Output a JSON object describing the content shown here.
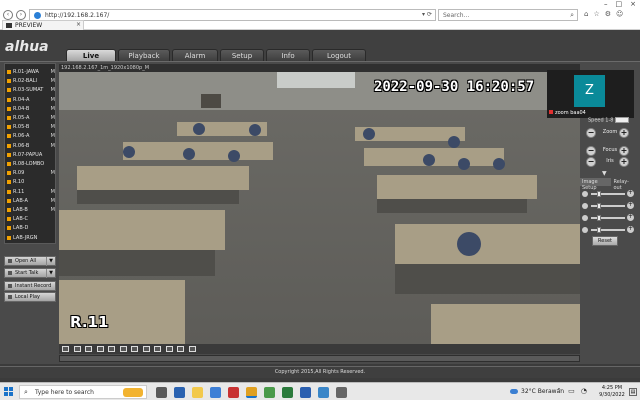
{
  "browser": {
    "url": "http://192.168.2.167/",
    "search_placeholder": "Search...",
    "tab_title": "PREVIEW"
  },
  "app": {
    "logo": "alhua",
    "tabs": [
      "Live",
      "Playback",
      "Alarm",
      "Setup",
      "Info",
      "Logout"
    ],
    "active_tab": "Live",
    "footer": "Copyright 2015,All Rights Reserved."
  },
  "channels": [
    {
      "name": "R.01-JAWA",
      "m": "M"
    },
    {
      "name": "R.02-BALI",
      "m": "M"
    },
    {
      "name": "R.03-SUMAT",
      "m": "M"
    },
    {
      "name": "R.04-A",
      "m": "M"
    },
    {
      "name": "R.04-B",
      "m": "M"
    },
    {
      "name": "R.05-A",
      "m": "M"
    },
    {
      "name": "R.05-B",
      "m": "M"
    },
    {
      "name": "R.06-A",
      "m": "M"
    },
    {
      "name": "R.06-B",
      "m": "M"
    },
    {
      "name": "R.07-PAPUA",
      "m": ""
    },
    {
      "name": "R.08-LOMBO",
      "m": ""
    },
    {
      "name": "R.09",
      "m": "M"
    },
    {
      "name": "R.10",
      "m": ""
    },
    {
      "name": "R.11",
      "m": "M"
    },
    {
      "name": "LAB-A",
      "m": "M"
    },
    {
      "name": "LAB-B",
      "m": "M"
    },
    {
      "name": "LAB-C",
      "m": ""
    },
    {
      "name": "LAB-D",
      "m": ""
    },
    {
      "name": "LAB-JRGN",
      "m": ""
    }
  ],
  "left_buttons": [
    "Open All",
    "Start Talk",
    "Instant Record",
    "Local Play"
  ],
  "video": {
    "title": "192.168.2.167_1m_1920x1080p_M",
    "osd_time": "2022-09-30 16:20:57",
    "osd_name": "R.11"
  },
  "zoom": {
    "tile_letter": "Z",
    "label": "zoom baa04"
  },
  "ptz": {
    "speed_label": "Speed 1-8",
    "controls": [
      "Zoom",
      "Focus",
      "Iris"
    ]
  },
  "image_setup": {
    "tabs": [
      "Image Setup",
      "Relay-out"
    ],
    "sliders": [
      0.2,
      0.2,
      0.2,
      0.2
    ],
    "reset_label": "Reset"
  },
  "taskbar": {
    "search_placeholder": "Type here to search",
    "weather": "32°C  Berawan",
    "time": "4:25 PM",
    "date": "9/30/2022"
  }
}
